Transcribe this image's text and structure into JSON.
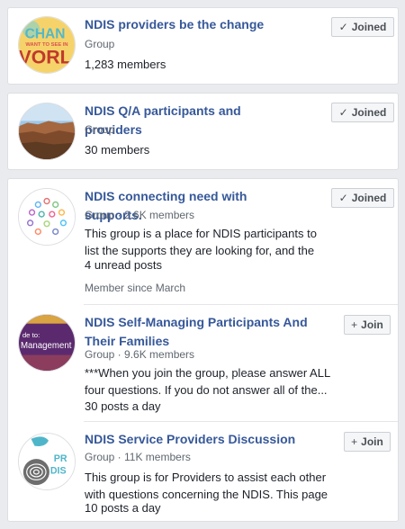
{
  "groups": [
    {
      "name": "NDIS providers be the change",
      "type": "Group",
      "members": "1,283 members",
      "button": {
        "icon": "check-icon",
        "glyph": "✓",
        "label": "Joined"
      }
    },
    {
      "name": "NDIS Q/A participants and providers",
      "type": "Group",
      "members": "30 members",
      "button": {
        "icon": "check-icon",
        "glyph": "✓",
        "label": "Joined"
      }
    },
    {
      "name": "NDIS connecting need with supports.",
      "meta": "Group · 2.6K members",
      "description": "This group is a place for NDIS participants to list the supports they are looking for, and the locatio...",
      "activity": "4 unread posts",
      "member_since": "Member since March",
      "button": {
        "icon": "check-icon",
        "glyph": "✓",
        "label": "Joined"
      }
    },
    {
      "name": "NDIS Self-Managing Participants And Their Families",
      "meta": "Group · 9.6K members",
      "description": "***When you join the group, please answer ALL four questions. If you do not answer all of the...",
      "activity": "30 posts a day",
      "button": {
        "icon": "plus-icon",
        "glyph": "+",
        "label": "Join"
      }
    },
    {
      "name": "NDIS Service Providers Discussion",
      "meta": "Group · 11K members",
      "description": "This group is for Providers to assist each other with questions concerning the NDIS. This page is...",
      "activity": "10 posts a day",
      "button": {
        "icon": "plus-icon",
        "glyph": "+",
        "label": "Join"
      }
    }
  ],
  "avatar_text": {
    "g0_line1": "CHAN",
    "g0_line2": "WANT TO SEE IN",
    "g0_line3": "VORL",
    "g3_line1": "de to:",
    "g3_line2": "Management",
    "g4_line1": "PR",
    "g4_line2": "DIS"
  },
  "colors": {
    "link": "#365899",
    "background": "#e9ebee"
  }
}
